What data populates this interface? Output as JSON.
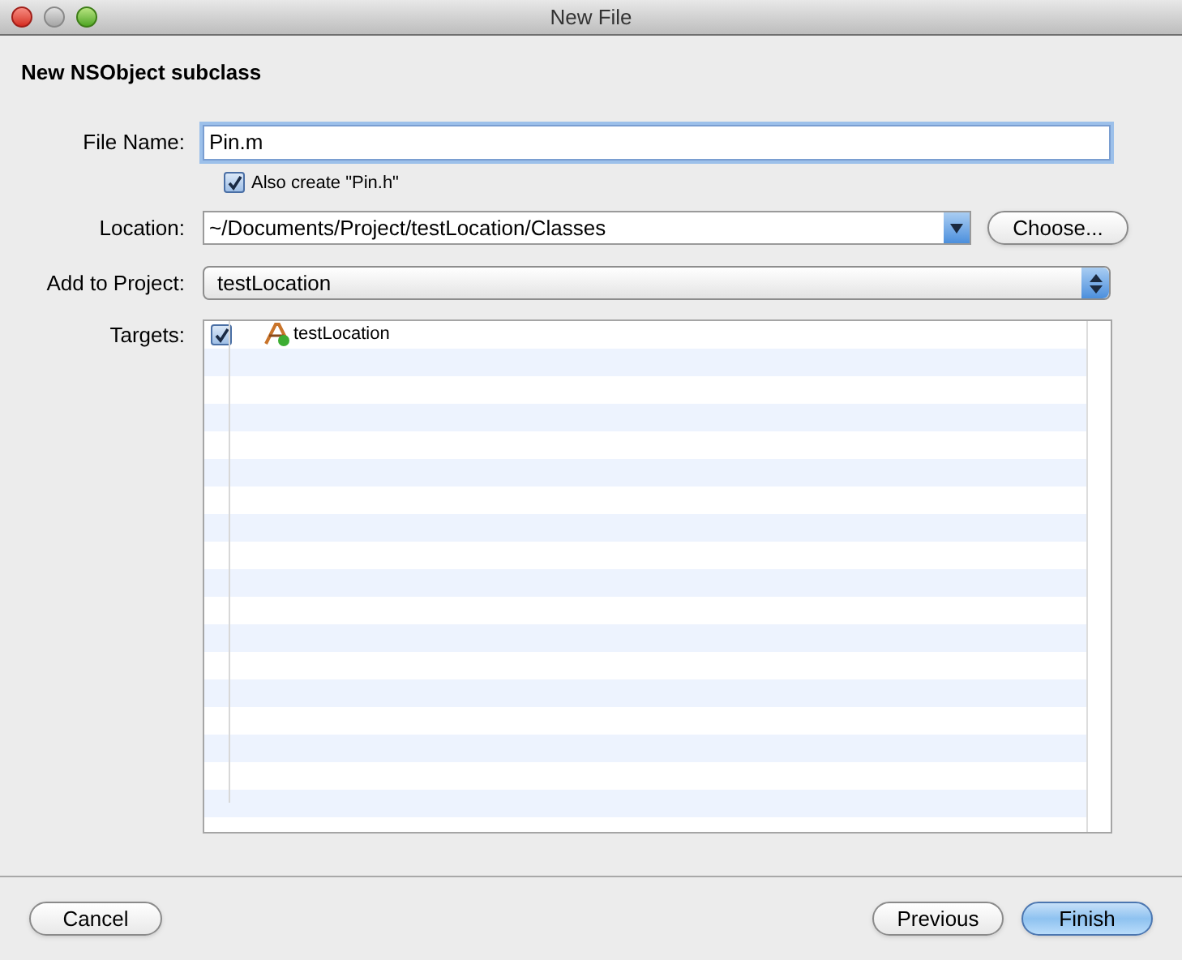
{
  "window": {
    "title": "New File"
  },
  "heading": "New NSObject subclass",
  "file_name": {
    "label": "File Name:",
    "value": "Pin.m"
  },
  "also_create": {
    "label": "Also create \"Pin.h\"",
    "checked": true
  },
  "location": {
    "label": "Location:",
    "value": "~/Documents/Project/testLocation/Classes",
    "button": "Choose..."
  },
  "add_to_project": {
    "label": "Add to Project:",
    "value": "testLocation"
  },
  "targets": {
    "label": "Targets:",
    "rows": [
      {
        "name": "testLocation",
        "checked": true
      }
    ]
  },
  "buttons": [
    {
      "label": "Cancel",
      "default": false
    },
    {
      "label": "Previous",
      "default": false
    },
    {
      "label": "Finish",
      "default": true
    }
  ]
}
